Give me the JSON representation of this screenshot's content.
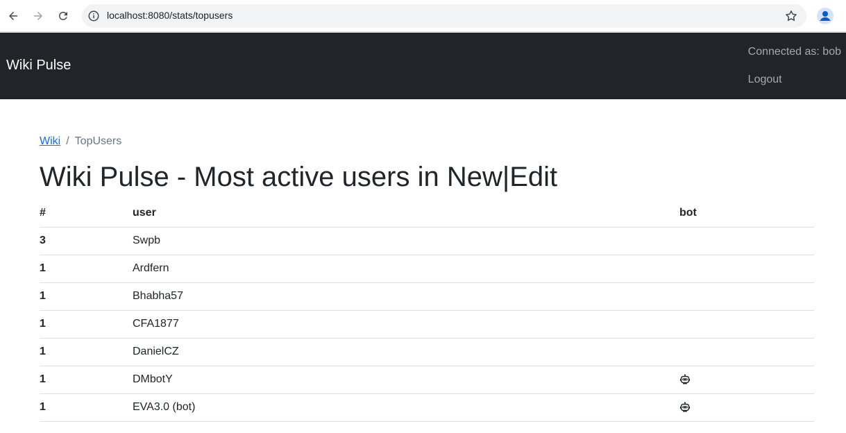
{
  "browser": {
    "url": "localhost:8080/stats/topusers",
    "icons": [
      "back-arrow-icon",
      "forward-arrow-icon",
      "reload-icon",
      "site-info-icon",
      "bookmark-star-icon",
      "profile-icon"
    ]
  },
  "navbar": {
    "brand": "Wiki Pulse",
    "connected_as": "Connected as: bob",
    "logout": "Logout",
    "bg_color": "#212529"
  },
  "breadcrumb": {
    "link": "Wiki",
    "separator": "/",
    "current": "TopUsers"
  },
  "page_title": "Wiki Pulse - Most active users in New|Edit",
  "table": {
    "headers": [
      "#",
      "user",
      "bot"
    ],
    "rows": [
      {
        "count": "3",
        "user": "Swpb",
        "bot": false
      },
      {
        "count": "1",
        "user": "Ardfern",
        "bot": false
      },
      {
        "count": "1",
        "user": "Bhabha57",
        "bot": false
      },
      {
        "count": "1",
        "user": "CFA1877",
        "bot": false
      },
      {
        "count": "1",
        "user": "DanielCZ",
        "bot": false
      },
      {
        "count": "1",
        "user": "DMbotY",
        "bot": true
      },
      {
        "count": "1",
        "user": "EVA3.0 (bot)",
        "bot": true
      }
    ]
  }
}
